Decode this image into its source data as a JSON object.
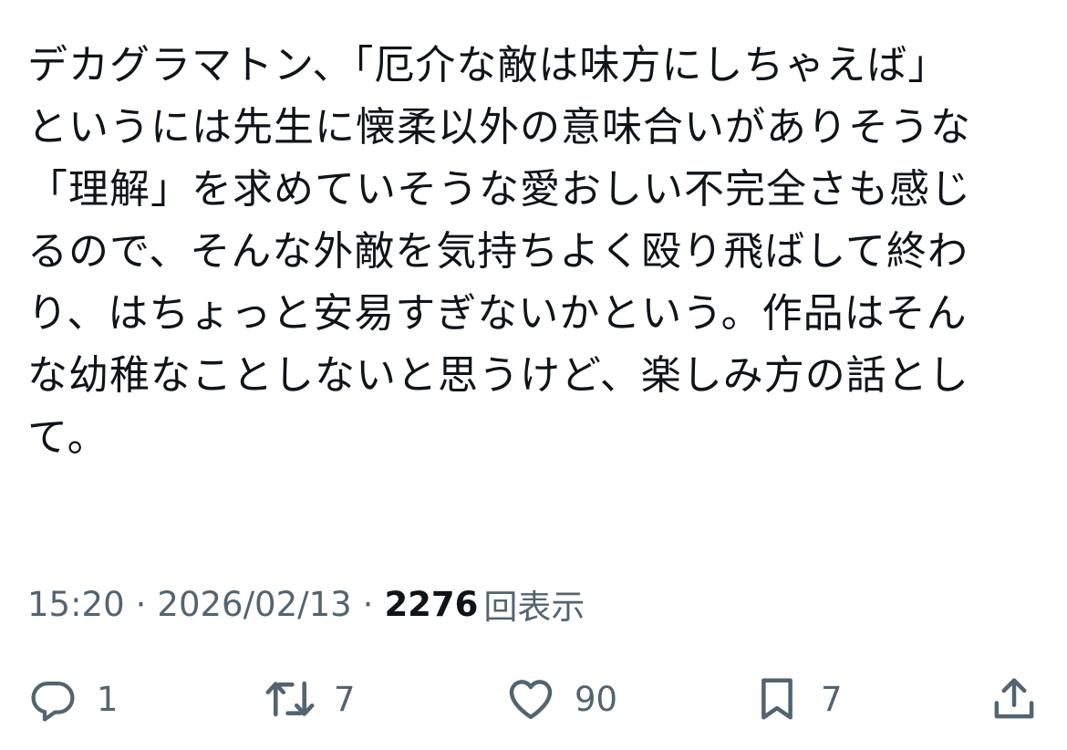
{
  "tweet": {
    "lines": [
      "デカグラマトン、「厄介な敵は味方にしちゃえば」",
      "というには先生に懐柔以外の意味合いがありそうな",
      "「理解」を求めていそうな愛おしい不完全さも感じ",
      "るので、そんな外敵を気持ちよく殴り飛ばして終わ",
      "り、はちょっと安易すぎないかという。作品はそん",
      "な幼稚なことしないと思うけど、楽しみ方の話とし",
      "て。"
    ]
  },
  "meta": {
    "time": "15:20",
    "separator": "·",
    "date": "2026/02/13",
    "views_count": "2276",
    "views_label": "回表示"
  },
  "actions": {
    "reply_count": "1",
    "repost_count": "7",
    "like_count": "90",
    "bookmark_count": "7"
  },
  "icons": {
    "reply": "reply-icon",
    "repost": "repost-icon",
    "like": "heart-icon",
    "bookmark": "bookmark-icon",
    "share": "share-icon"
  },
  "colors": {
    "text": "#0f1419",
    "secondary": "#536471",
    "background": "#ffffff"
  }
}
